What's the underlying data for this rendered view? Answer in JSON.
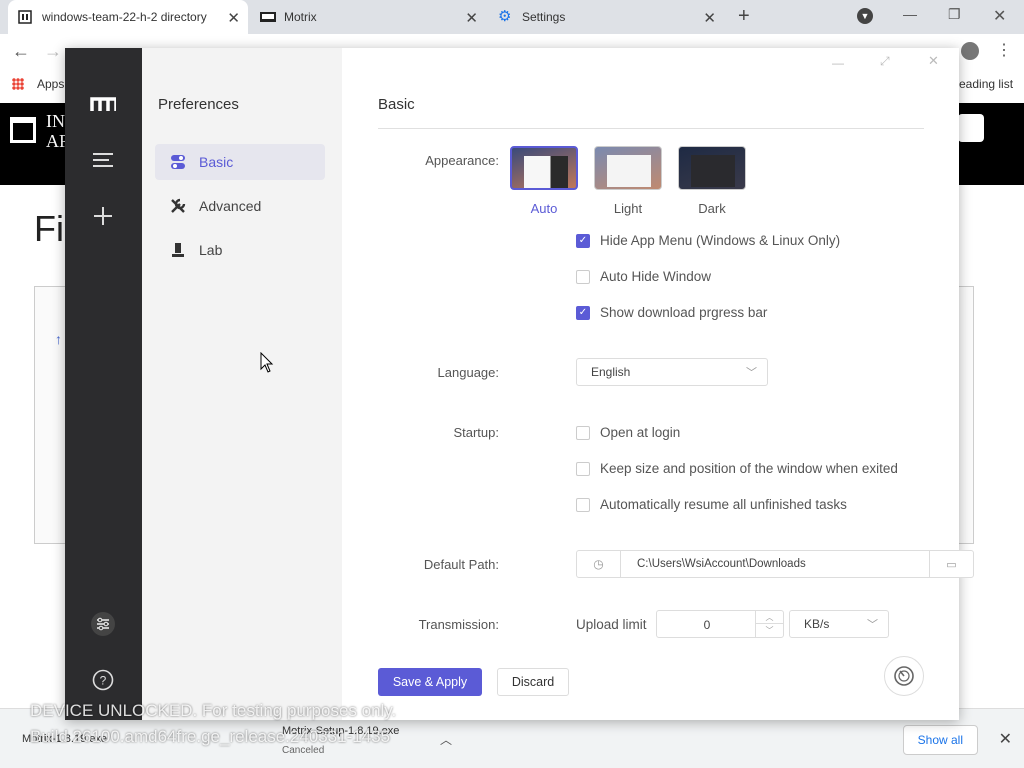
{
  "browser": {
    "tabs": [
      {
        "title": "windows-team-22-h-2 directory",
        "active": true
      },
      {
        "title": "Motrix",
        "active": false
      },
      {
        "title": "Settings",
        "active": false
      }
    ],
    "bookmarks": {
      "apps_label": "Apps",
      "reading_list_label": "eading list"
    }
  },
  "webpage": {
    "title_fragment": "Fi",
    "logo_fragment": "IN\nAR"
  },
  "downloads": {
    "item1_name": "Motrix-1.8.19.exe",
    "item2_name": "Motrix-Setup-1.8.19.exe",
    "item2_status": "Canceled",
    "show_all": "Show all"
  },
  "motrix": {
    "sub_title": "Preferences",
    "sub_items": [
      {
        "label": "Basic",
        "icon": "toggle-icon",
        "active": true
      },
      {
        "label": "Advanced",
        "icon": "wrench-icon",
        "active": false
      },
      {
        "label": "Lab",
        "icon": "lab-icon",
        "active": false
      }
    ],
    "main_title": "Basic",
    "appearance": {
      "label": "Appearance:",
      "options": [
        {
          "caption": "Auto",
          "selected": true
        },
        {
          "caption": "Light",
          "selected": false
        },
        {
          "caption": "Dark",
          "selected": false
        }
      ]
    },
    "appearance_checks": [
      {
        "label": "Hide App Menu (Windows & Linux Only)",
        "checked": true
      },
      {
        "label": "Auto Hide Window",
        "checked": false
      },
      {
        "label": "Show download prgress bar",
        "checked": true
      }
    ],
    "language": {
      "label": "Language:",
      "value": "English"
    },
    "startup": {
      "label": "Startup:",
      "checks": [
        {
          "label": "Open at login",
          "checked": false
        },
        {
          "label": "Keep size and position of the window when exited",
          "checked": false
        },
        {
          "label": "Automatically resume all unfinished tasks",
          "checked": false
        }
      ]
    },
    "default_path": {
      "label": "Default Path:",
      "value": "C:\\Users\\WsiAccount\\Downloads"
    },
    "transmission": {
      "label": "Transmission:",
      "upload_label": "Upload limit",
      "upload_value": "0",
      "unit": "KB/s"
    },
    "save_label": "Save & Apply",
    "discard_label": "Discard"
  },
  "watermark": {
    "line1": "DEVICE UNLOCKED. For testing purposes only.",
    "line2": "Build 26100.amd64fre.ge_release.240331-1435"
  },
  "colors": {
    "accent": "#5b5bd6",
    "sidebar": "#2c2c2e"
  }
}
